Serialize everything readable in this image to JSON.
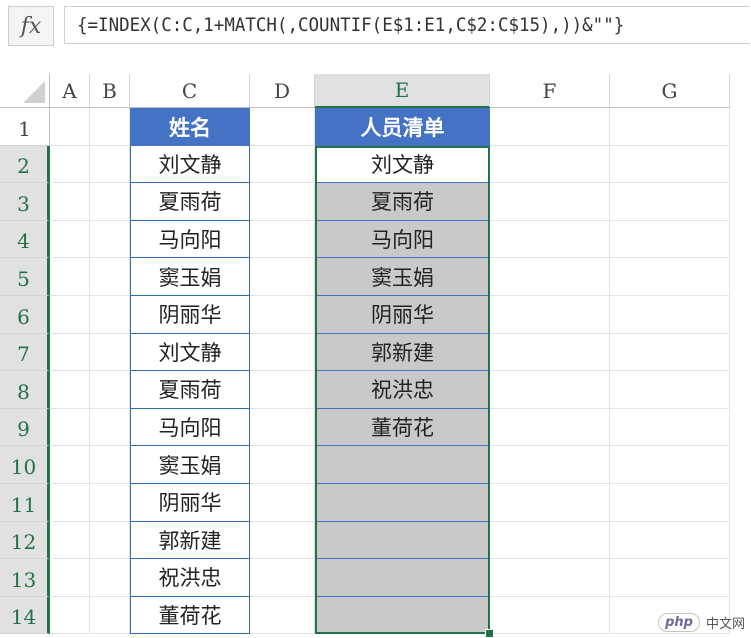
{
  "formula_bar": {
    "fx_label": "fx",
    "formula": "{=INDEX(C:C,1+MATCH(,COUNTIF(E$1:E1,C$2:C$15),))&\"\"}"
  },
  "columns": [
    "A",
    "B",
    "C",
    "D",
    "E",
    "F",
    "G"
  ],
  "selected_column": "E",
  "rows": [
    "1",
    "2",
    "3",
    "4",
    "5",
    "6",
    "7",
    "8",
    "9",
    "10",
    "11",
    "12",
    "13",
    "14"
  ],
  "header_c": "姓名",
  "header_e": "人员清单",
  "names_c": [
    "刘文静",
    "夏雨荷",
    "马向阳",
    "窦玉娟",
    "阴丽华",
    "刘文静",
    "夏雨荷",
    "马向阳",
    "窦玉娟",
    "阴丽华",
    "郭新建",
    "祝洪忠",
    "董荷花"
  ],
  "list_e": [
    "刘文静",
    "夏雨荷",
    "马向阳",
    "窦玉娟",
    "阴丽华",
    "郭新建",
    "祝洪忠",
    "董荷花",
    "",
    "",
    "",
    "",
    ""
  ],
  "watermark": {
    "logo": "php",
    "text": "中文网"
  }
}
